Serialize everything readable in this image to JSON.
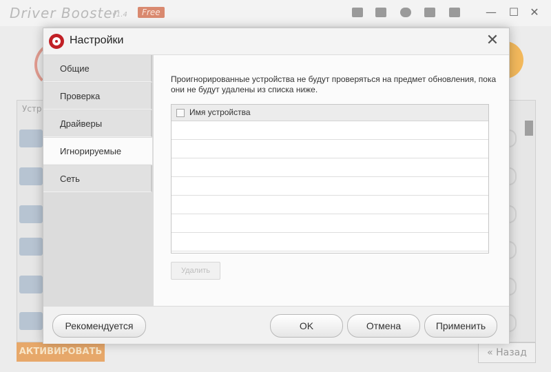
{
  "background_app": {
    "title": "Driver Booster",
    "version": "v1.4",
    "edition_badge": "Free",
    "column_header": "Устр",
    "activate_label": "АКТИВИРОВАТЬ",
    "back_label": "Назад",
    "back_icon": "double-chevron-left"
  },
  "dialog": {
    "title": "Настройки",
    "close_symbol": "✕",
    "sidebar": {
      "items": [
        {
          "label": "Общие",
          "active": false
        },
        {
          "label": "Проверка",
          "active": false
        },
        {
          "label": "Драйверы",
          "active": false
        },
        {
          "label": "Игнорируемые",
          "active": true
        },
        {
          "label": "Сеть",
          "active": false
        }
      ]
    },
    "ignored": {
      "description": "Проигнорированные устройства не будут проверяться на предмет обновления, пока они не будут удалены из списка ниже.",
      "column_header": "Имя устройства",
      "row_count": 7,
      "delete_label": "Удалить"
    },
    "footer": {
      "recommended_label": "Рекомендуется",
      "ok_label": "OK",
      "cancel_label": "Отмена",
      "apply_label": "Применить"
    }
  },
  "colors": {
    "accent_red": "#c12026",
    "active_tab_bg": "#fbfbfb",
    "sidebar_bg": "#e1e1e1"
  }
}
